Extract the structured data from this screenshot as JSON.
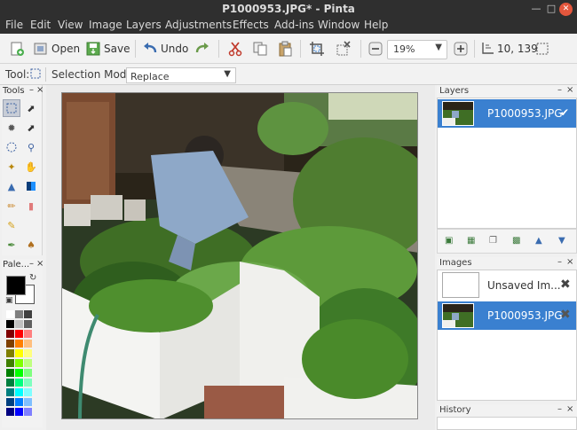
{
  "window": {
    "title": "P1000953.JPG* - Pinta"
  },
  "menu": [
    "File",
    "Edit",
    "View",
    "Image",
    "Layers",
    "Adjustments",
    "Effects",
    "Add-ins",
    "Window",
    "Help"
  ],
  "toolbar": {
    "open_label": "Open",
    "save_label": "Save",
    "undo_label": "Undo",
    "zoom_value": "19%",
    "cursor_position": "10, 139"
  },
  "tool_options": {
    "tool_label": "Tool:",
    "mode_label": "Selection Mode:",
    "mode_value": "Replace"
  },
  "panels": {
    "tools_title": "Tools",
    "palette_title": "Pale...",
    "layers_title": "Layers",
    "images_title": "Images",
    "history_title": "History"
  },
  "layers": [
    {
      "name": "P1000953.JPG",
      "visible": true
    }
  ],
  "images": [
    {
      "name": "Unsaved Im...",
      "selected": false
    },
    {
      "name": "P1000953.JPG",
      "selected": true
    }
  ],
  "colors": {
    "primary": "#000000",
    "secondary": "#ffffff",
    "accent": "#3a80d0"
  }
}
